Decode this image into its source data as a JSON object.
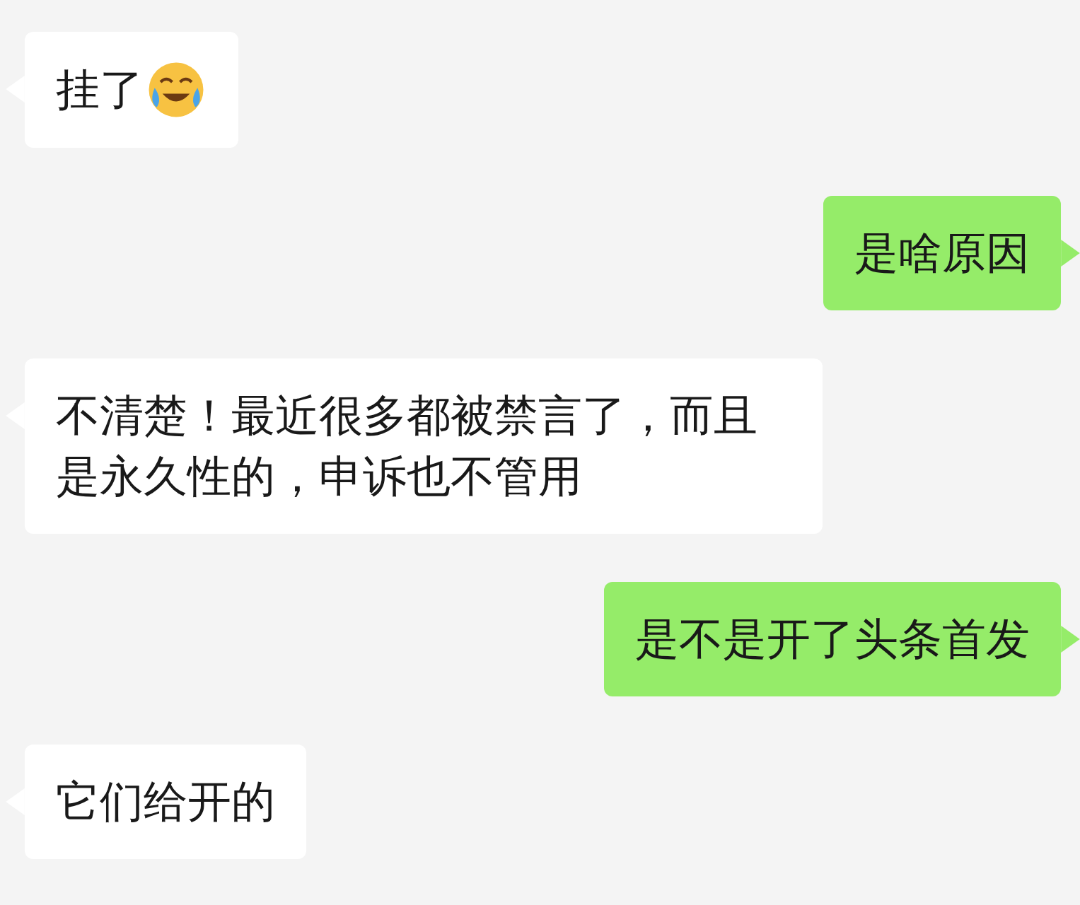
{
  "messages": [
    {
      "kind": "incoming",
      "text": "挂了",
      "emoji": true
    },
    {
      "kind": "outgoing",
      "text": "是啥原因",
      "emoji": false
    },
    {
      "kind": "incoming",
      "text": "不清楚！最近很多都被禁言了，而且是永久性的，申诉也不管用",
      "emoji": false
    },
    {
      "kind": "outgoing",
      "text": "是不是开了头条首发",
      "emoji": false
    },
    {
      "kind": "incoming",
      "text": "它们给开的",
      "emoji": false
    }
  ]
}
